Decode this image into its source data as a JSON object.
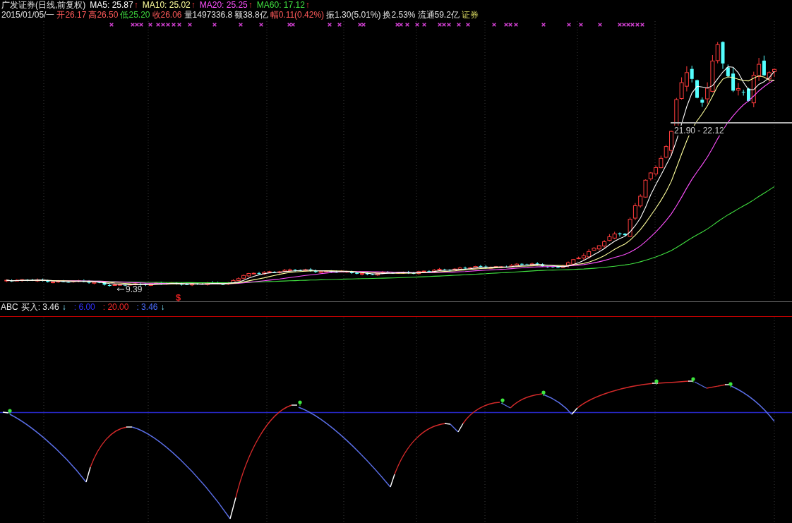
{
  "header": {
    "title": "广发证券(日线,前复权)",
    "moving_averages": [
      {
        "label": "MA5: 25.87",
        "arrow": "↑",
        "color": "#ffffff"
      },
      {
        "label": "MA10: 25.02",
        "arrow": "↑",
        "color": "#ffff9c"
      },
      {
        "label": "MA20: 25.25",
        "arrow": "↑",
        "color": "#ff50ff"
      },
      {
        "label": "MA60: 17.12",
        "arrow": "↑",
        "color": "#40e040"
      }
    ]
  },
  "quote": [
    {
      "text": "2015/01/05/一",
      "color": "#e0e0e0"
    },
    {
      "text": "开26.17",
      "color": "#ff5a5a"
    },
    {
      "text": "高26.50",
      "color": "#ff5a5a"
    },
    {
      "text": "低25.20",
      "color": "#3cd23c"
    },
    {
      "text": "收26.06",
      "color": "#ff5a5a"
    },
    {
      "text": "量1497336.8",
      "color": "#e0e0e0"
    },
    {
      "text": "额38.8亿",
      "color": "#e0e0e0"
    },
    {
      "text": "幅0.11(0.42%)",
      "color": "#ff5a5a"
    },
    {
      "text": "振1.30(5.01%)",
      "color": "#e0e0e0"
    },
    {
      "text": "换2.53%",
      "color": "#e0e0e0"
    },
    {
      "text": "流通59.2亿",
      "color": "#e0e0e0"
    },
    {
      "text": "证券",
      "color": "#d8d860"
    }
  ],
  "price_chart": {
    "range_label": "21.90 - 22.12",
    "low_label": "9.39",
    "signal_mark": "$"
  },
  "indicator": {
    "name": "ABC",
    "label": "买入: 3.46",
    "arrow": "↓",
    "values": [
      {
        "text": ": 6.00",
        "color": "#3030ff"
      },
      {
        "text": ": 20.00",
        "color": "#ff2828"
      },
      {
        "text": ": 3.46",
        "color": "#4a6cff",
        "arrow": "↓"
      }
    ]
  }
}
